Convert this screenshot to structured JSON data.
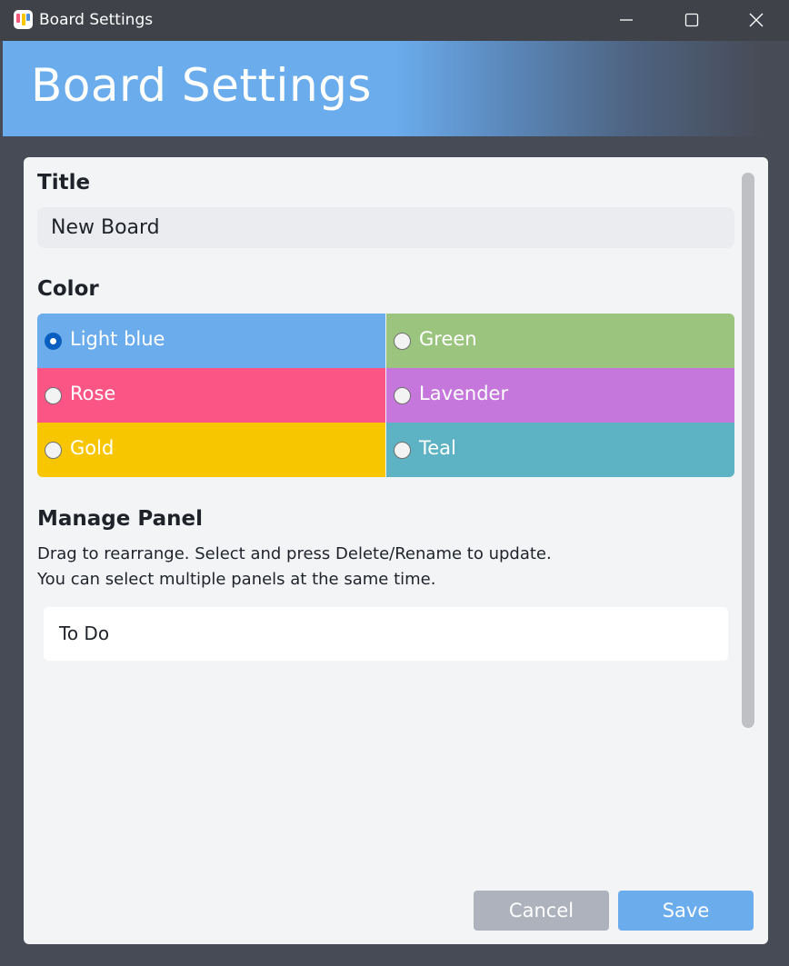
{
  "window": {
    "title": "Board Settings",
    "controls": [
      "minimize-icon",
      "maximize-icon",
      "close-icon"
    ]
  },
  "header": {
    "title": "Board Settings"
  },
  "form": {
    "title_label": "Title",
    "title_value": "New Board",
    "color_label": "Color",
    "colors": [
      {
        "label": "Light blue",
        "hex": "#6baced",
        "selected": true
      },
      {
        "label": "Green",
        "hex": "#9bc47e",
        "selected": false
      },
      {
        "label": "Rose",
        "hex": "#fa5585",
        "selected": false
      },
      {
        "label": "Lavender",
        "hex": "#c577db",
        "selected": false
      },
      {
        "label": "Gold",
        "hex": "#f8c601",
        "selected": false
      },
      {
        "label": "Teal",
        "hex": "#5db3c3",
        "selected": false
      }
    ],
    "manage_label": "Manage Panel",
    "help_line1": "Drag to rearrange. Select and press Delete/Rename to update.",
    "help_line2": "You can select multiple panels at the same time.",
    "panels": [
      "To Do"
    ]
  },
  "actions": {
    "cancel": "Cancel",
    "save": "Save"
  },
  "theme": {
    "accent": "#6baced",
    "cancel_bg": "#adb2bd",
    "save_bg": "#6baced",
    "radio_checked": "#0a5ec0"
  }
}
